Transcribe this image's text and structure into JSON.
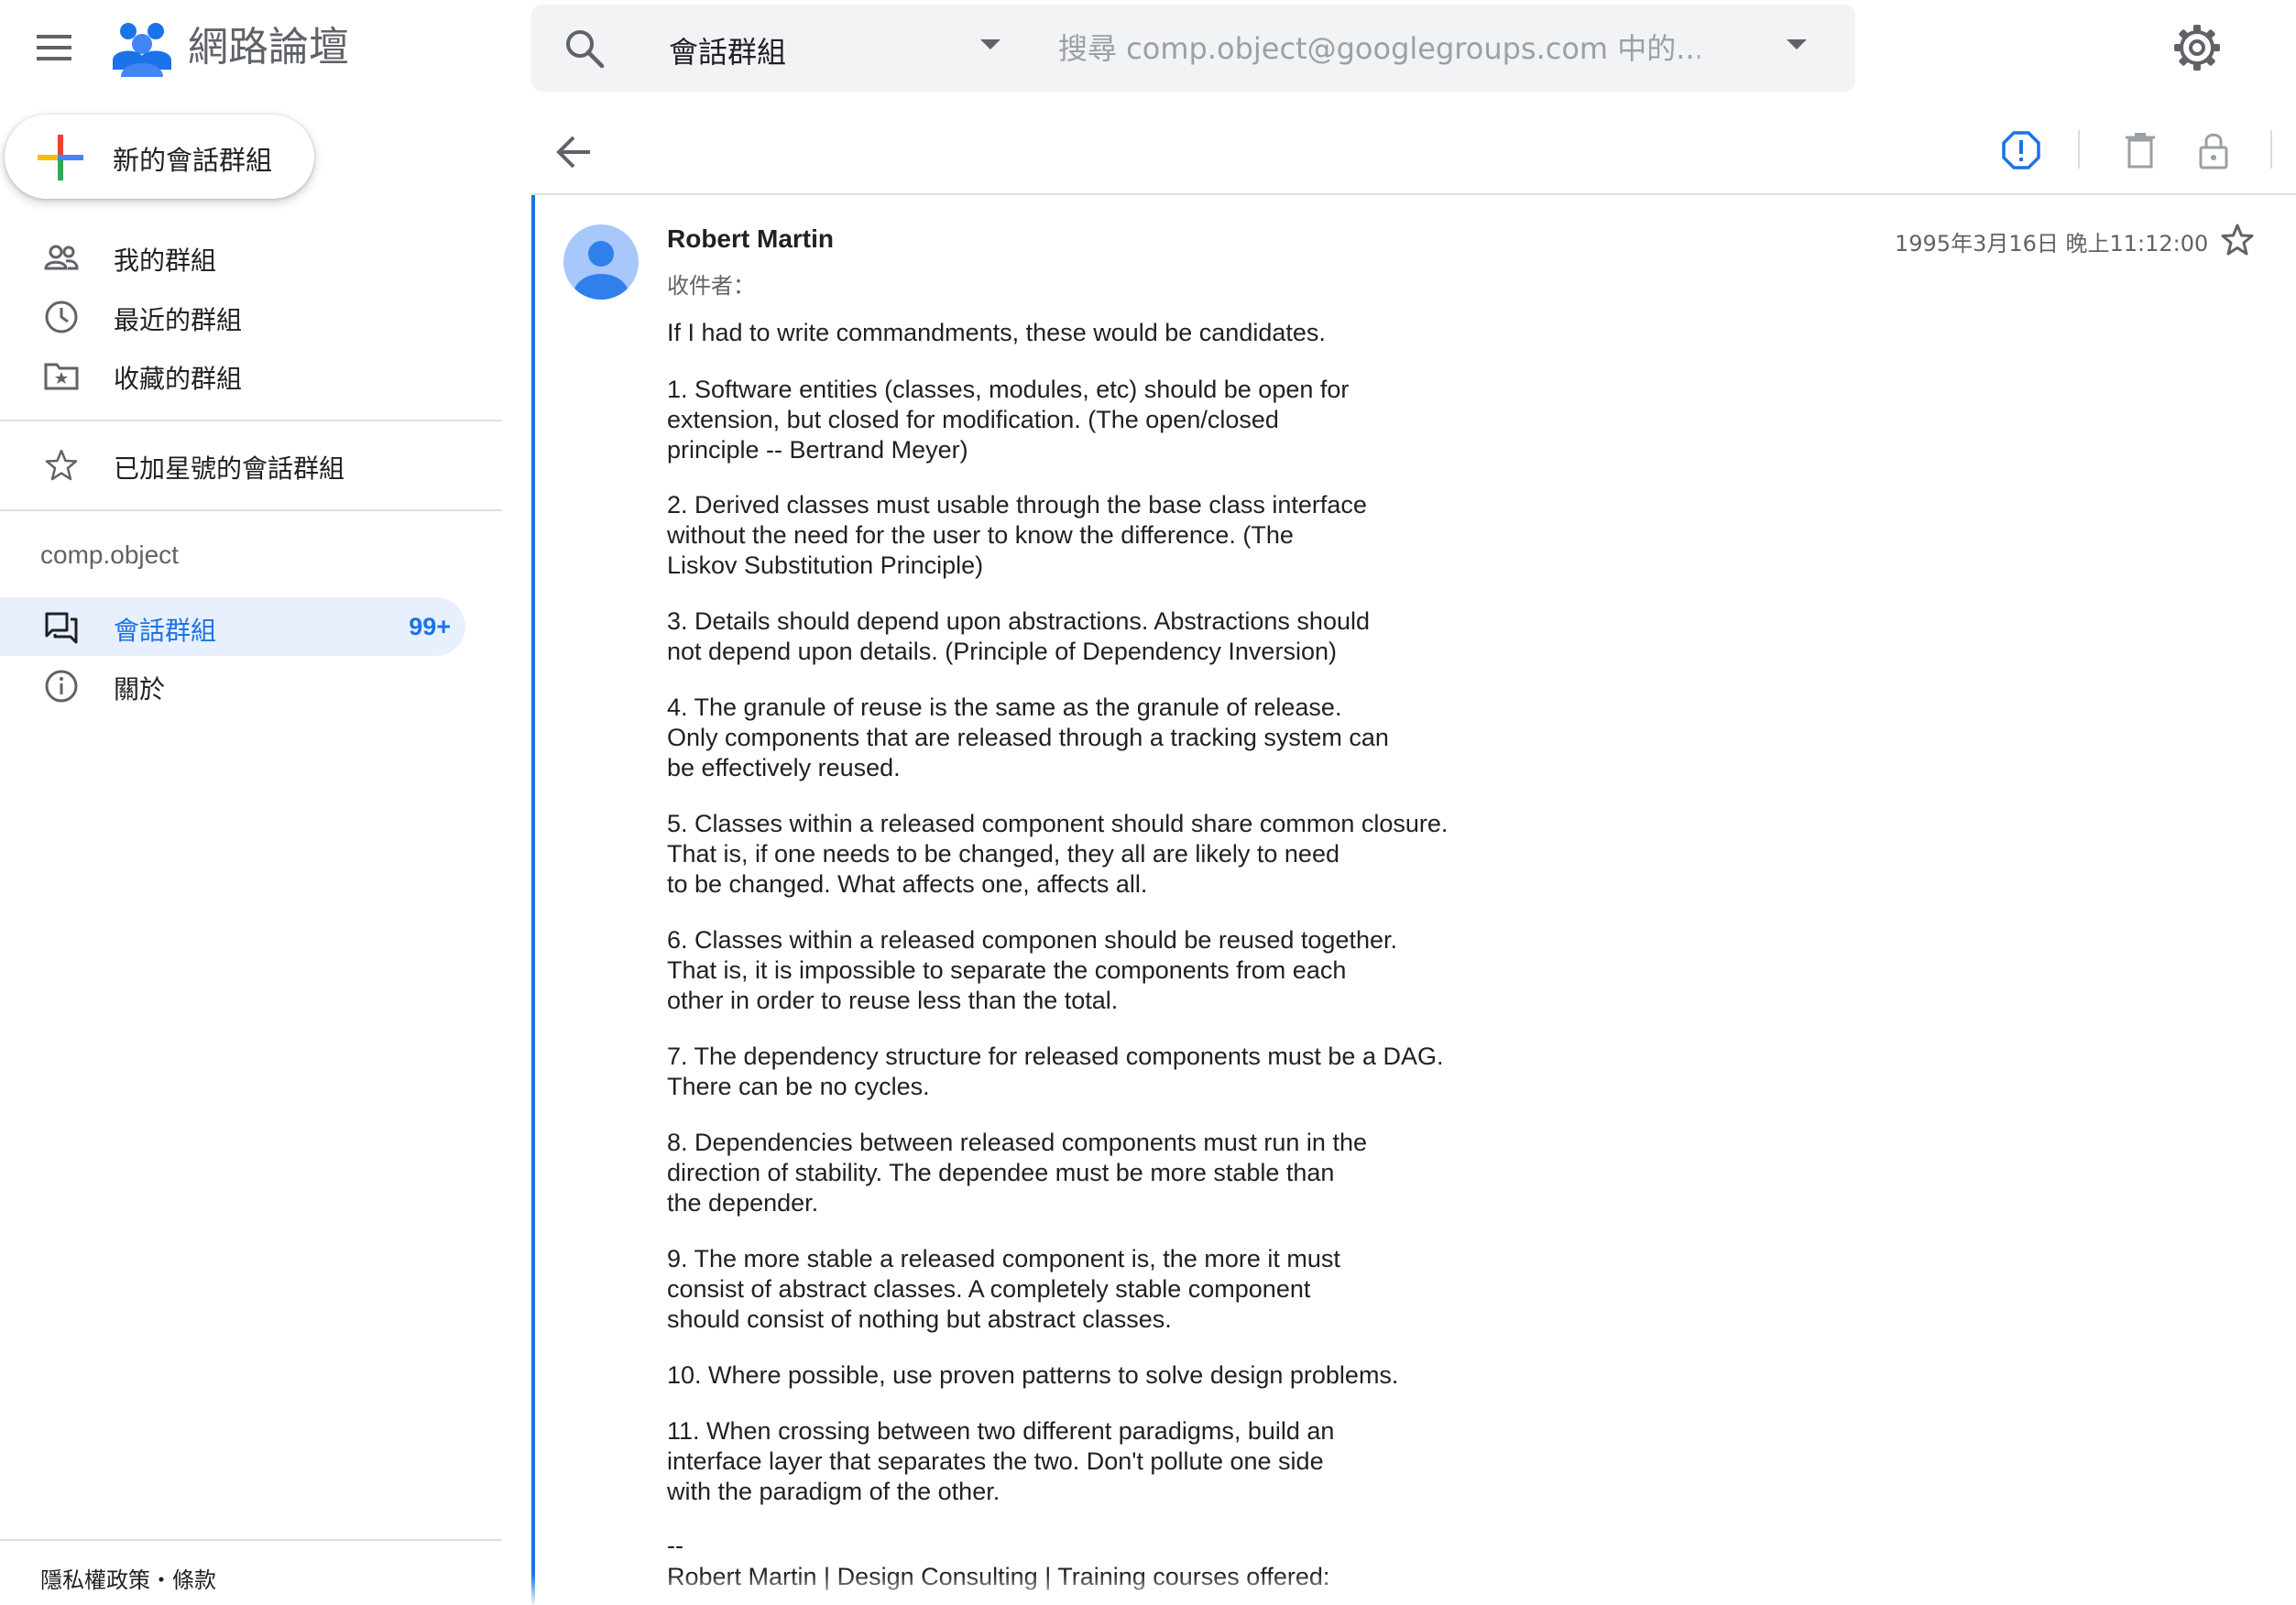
{
  "header": {
    "app_title": "網路論壇",
    "search": {
      "scope": "會話群組",
      "placeholder": "搜尋 comp.object@googlegroups.com 中的..."
    }
  },
  "sidebar": {
    "new_conversation_label": "新的會話群組",
    "items": [
      {
        "label": "我的群組",
        "icon": "people-icon"
      },
      {
        "label": "最近的群組",
        "icon": "clock-icon"
      },
      {
        "label": "收藏的群組",
        "icon": "star-folder-icon"
      }
    ],
    "starred_label": "已加星號的會話群組",
    "group_name": "comp.object",
    "group_items": [
      {
        "label": "會話群組",
        "count": "99+",
        "icon": "forum-icon",
        "active": true
      },
      {
        "label": "關於",
        "icon": "info-icon"
      }
    ],
    "footer": "隱私權政策・條款"
  },
  "message": {
    "sender": "Robert Martin",
    "recipient_label": "收件者：",
    "timestamp": "1995年3月16日 晚上11:12:00",
    "paragraphs": [
      "If I had to write commandments, these would be candidates.",
      "1. Software entities (classes, modules, etc) should be open for\nextension, but closed for modification. (The open/closed\nprinciple -- Bertrand Meyer)",
      "2. Derived classes must usable through the base class interface\nwithout the need for the user to know the difference. (The\nLiskov Substitution Principle)",
      "3. Details should depend upon abstractions. Abstractions should\nnot depend upon details. (Principle of Dependency Inversion)",
      "4. The granule of reuse is the same as the granule of release.\nOnly components that are released through a tracking system can\nbe effectively reused.",
      "5. Classes within a released component should share common closure.\nThat is, if one needs to be changed, they all are likely to need\nto be changed. What affects one, affects all.",
      "6. Classes within a released componen should be reused together.\nThat is, it is impossible to separate the components from each\nother in order to reuse less than the total.",
      "7. The dependency structure for released components must be a DAG.\nThere can be no cycles.",
      "8. Dependencies between released components must run in the\ndirection of stability. The dependee must be more stable than\nthe depender.",
      "9. The more stable a released component is, the more it must\nconsist of abstract classes. A completely stable component\nshould consist of nothing but abstract classes.",
      "10. Where possible, use proven patterns to solve design problems.",
      "11. When crossing between two different paradigms, build an\ninterface layer that separates the two. Don't pollute one side\nwith the paradigm of the other."
    ],
    "signature_dash": "--",
    "signature": "Robert Martin | Design Consulting | Training courses offered:"
  },
  "colors": {
    "accent": "#1a73e8",
    "active_bg": "#e8f0fe",
    "icon_gray": "#5f6368"
  }
}
